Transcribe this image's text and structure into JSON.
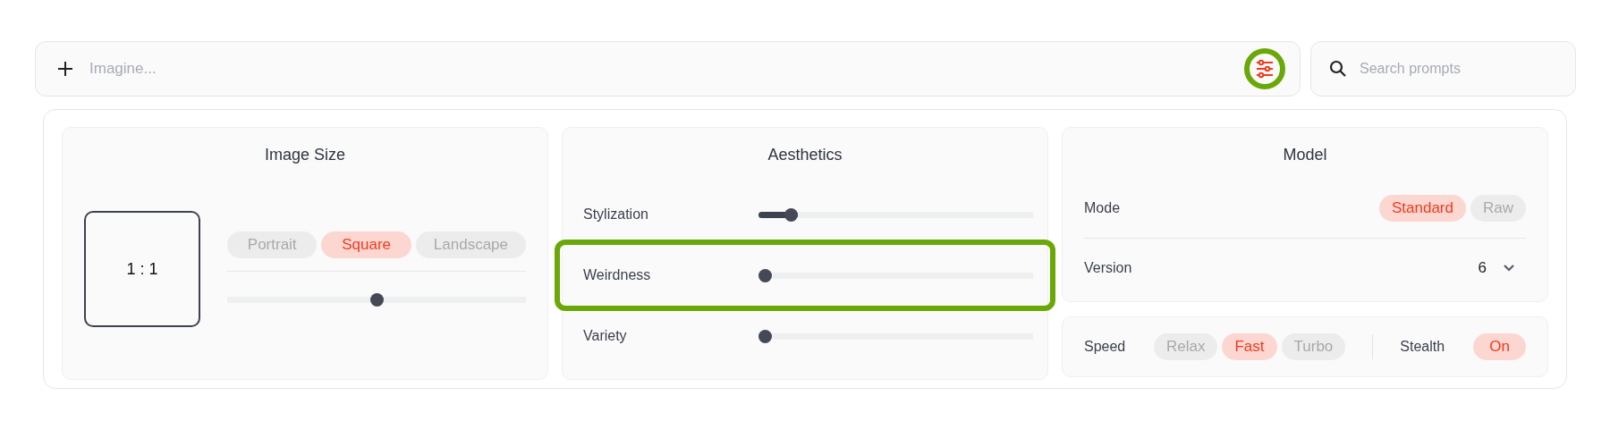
{
  "prompt_bar": {
    "placeholder": "Imagine...",
    "settings_highlighted": true
  },
  "search": {
    "placeholder": "Search prompts"
  },
  "image_size": {
    "title": "Image Size",
    "ratio": "1 : 1",
    "orientations": [
      {
        "label": "Portrait",
        "selected": false
      },
      {
        "label": "Square",
        "selected": true
      },
      {
        "label": "Landscape",
        "selected": false
      }
    ],
    "level": 0.5
  },
  "aesthetics": {
    "title": "Aesthetics",
    "sliders": [
      {
        "label": "Stylization",
        "level": 0.1,
        "highlighted": false
      },
      {
        "label": "Weirdness",
        "level": 0,
        "highlighted": true
      },
      {
        "label": "Variety",
        "level": 0,
        "highlighted": false
      }
    ]
  },
  "model": {
    "title": "Model",
    "mode_label": "Mode",
    "modes": [
      {
        "label": "Standard",
        "selected": true
      },
      {
        "label": "Raw",
        "selected": false
      }
    ],
    "version_label": "Version",
    "version": "6"
  },
  "speed": {
    "label": "Speed",
    "options": [
      {
        "label": "Relax",
        "selected": false
      },
      {
        "label": "Fast",
        "selected": true
      },
      {
        "label": "Turbo",
        "selected": false
      }
    ],
    "stealth_label": "Stealth",
    "stealth": {
      "label": "On",
      "on": true
    }
  }
}
